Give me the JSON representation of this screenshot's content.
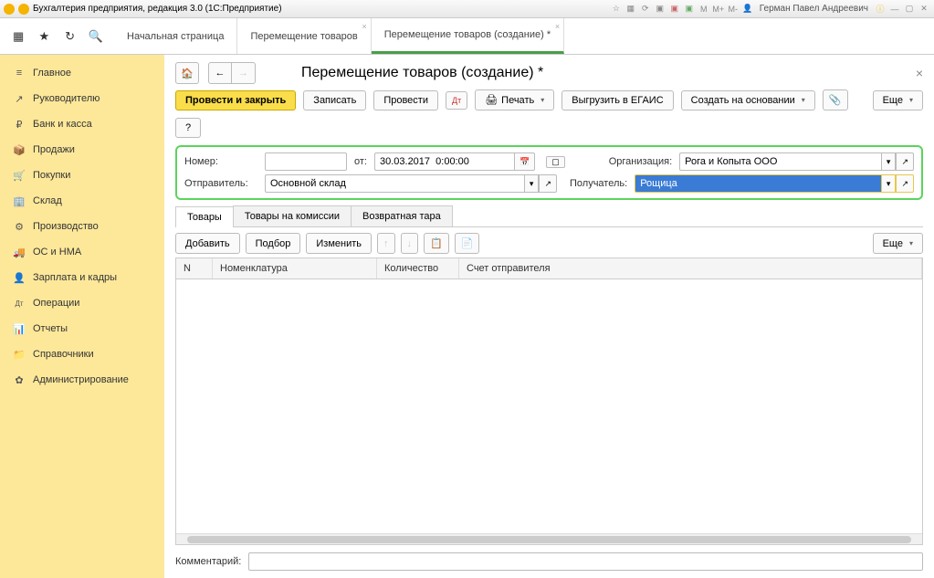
{
  "titlebar": {
    "app_title": "Бухгалтерия предприятия, редакция 3.0  (1С:Предприятие)",
    "user": "Герман Павел Андреевич"
  },
  "tabs": [
    {
      "label": "Начальная страница",
      "active": false,
      "closable": false
    },
    {
      "label": "Перемещение товаров",
      "active": false,
      "closable": true
    },
    {
      "label": "Перемещение товаров (создание) *",
      "active": true,
      "closable": true
    }
  ],
  "sidebar": [
    {
      "icon": "≡",
      "label": "Главное"
    },
    {
      "icon": "↗",
      "label": "Руководителю"
    },
    {
      "icon": "₽",
      "label": "Банк и касса"
    },
    {
      "icon": "📦",
      "label": "Продажи"
    },
    {
      "icon": "🛒",
      "label": "Покупки"
    },
    {
      "icon": "🏢",
      "label": "Склад"
    },
    {
      "icon": "⚙",
      "label": "Производство"
    },
    {
      "icon": "🚚",
      "label": "ОС и НМА"
    },
    {
      "icon": "👤",
      "label": "Зарплата и кадры"
    },
    {
      "icon": "Дт",
      "label": "Операции"
    },
    {
      "icon": "📊",
      "label": "Отчеты"
    },
    {
      "icon": "📁",
      "label": "Справочники"
    },
    {
      "icon": "✿",
      "label": "Администрирование"
    }
  ],
  "doc": {
    "title": "Перемещение товаров (создание) *",
    "toolbar": {
      "post_close": "Провести и закрыть",
      "write": "Записать",
      "post": "Провести",
      "print": "Печать",
      "egais": "Выгрузить в ЕГАИС",
      "create_based": "Создать на основании",
      "more": "Еще",
      "help": "?"
    },
    "fields": {
      "number_label": "Номер:",
      "number_value": "",
      "from_label": "от:",
      "date_value": "30.03.2017  0:00:00",
      "org_label": "Организация:",
      "org_value": "Рога и Копыта ООО",
      "sender_label": "Отправитель:",
      "sender_value": "Основной склад",
      "receiver_label": "Получатель:",
      "receiver_value": "Рощица"
    },
    "subtabs": [
      "Товары",
      "Товары на комиссии",
      "Возвратная тара"
    ],
    "grid_toolbar": {
      "add": "Добавить",
      "pick": "Подбор",
      "edit": "Изменить",
      "more": "Еще"
    },
    "grid_columns": {
      "n": "N",
      "nom": "Номенклатура",
      "qty": "Количество",
      "acc": "Счет отправителя"
    },
    "comment_label": "Комментарий:",
    "comment_value": ""
  }
}
